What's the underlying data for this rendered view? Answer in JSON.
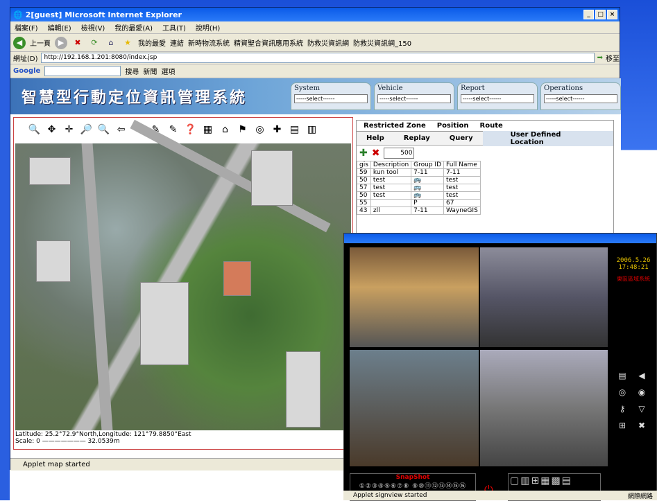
{
  "window": {
    "title": "2[guest]  Microsoft Internet Explorer"
  },
  "menu": [
    "檔案(F)",
    "編輯(E)",
    "檢視(V)",
    "我的最愛(A)",
    "工具(T)",
    "說明(H)"
  ],
  "toolbar": {
    "back": "上一頁",
    "links_label": "連結",
    "favorites": "我的最愛",
    "links": [
      "新時物流系統",
      "精資聖合資訊應用系統",
      "防救災資訊網",
      "防救災資訊網_150"
    ]
  },
  "address": {
    "label": "網址(D)",
    "value": "http://192.168.1.201:8080/index.jsp",
    "go": "移至"
  },
  "google": {
    "logo": "Google",
    "search": "搜尋",
    "news": "新聞",
    "options": "選項"
  },
  "app": {
    "banner_title": "智慧型行動定位資訊管理系統",
    "menus": [
      {
        "name": "System",
        "select": "-----select------"
      },
      {
        "name": "Vehicle",
        "select": "-----select------"
      },
      {
        "name": "Report",
        "select": "-----select------"
      },
      {
        "name": "Operations",
        "select": "-----select------"
      }
    ],
    "map_tools": [
      "🔍",
      "✥",
      "✛",
      "🔎",
      "🔍",
      "⇦",
      "⇨",
      "✎",
      "✎",
      "❓",
      "▦",
      "⌂",
      "⚑",
      "◎",
      "✚",
      "▤",
      "▥"
    ],
    "map_info": {
      "lat": "Latitude: 25.2°72.9°North,Longitude: 121°79.8850°East",
      "scale": "Scale: 0 ——————— 32.0539m"
    },
    "panel": {
      "tabs": [
        "Restricted Zone",
        "Position",
        "Route"
      ],
      "subtabs": [
        "Help",
        "Replay",
        "Query",
        "User Defined Location"
      ],
      "qty": "500",
      "columns": [
        "gis",
        "Description",
        "Group ID",
        "Full Name"
      ],
      "rows": [
        [
          "59",
          "kun tool",
          "7-11",
          "7-11"
        ],
        [
          "50",
          "test",
          "🚌",
          "test"
        ],
        [
          "57",
          "test",
          "🚌",
          "test"
        ],
        [
          "50",
          "test",
          "🚌",
          "test"
        ],
        [
          "55",
          "",
          "P",
          "67"
        ],
        [
          "43",
          "zll",
          "7-11",
          "WayneGIS"
        ]
      ]
    }
  },
  "status": "Applet map started",
  "camera": {
    "clock": {
      "date": "2006.5.26",
      "time": "17:48:21"
    },
    "zone": "東區區域系統",
    "snapshot": "SnapShot",
    "channels": "①②③④⑤⑥⑦⑧ ⑨⑩⑪⑫⑬⑭⑮⑯",
    "status": "Applet signview started",
    "net": "網際網路"
  }
}
